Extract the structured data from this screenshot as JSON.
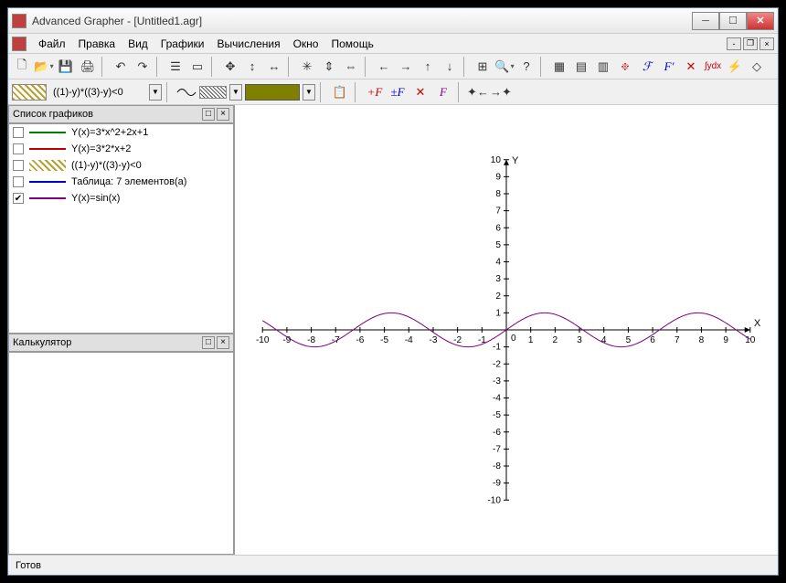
{
  "window": {
    "title": "Advanced Grapher - [Untitled1.agr]"
  },
  "menu": {
    "file": "Файл",
    "edit": "Правка",
    "view": "Вид",
    "graphs": "Графики",
    "calc": "Вычисления",
    "window": "Окно",
    "help": "Помощь"
  },
  "toolbar2": {
    "formula": "((1)-y)*((3)-y)<0"
  },
  "sidebar": {
    "graphs_title": "Список графиков",
    "calc_title": "Калькулятор",
    "items": [
      {
        "checked": false,
        "style": "line-green",
        "label": "Y(x)=3*x^2+2x+1"
      },
      {
        "checked": false,
        "style": "line-red",
        "label": "Y(x)=3*2*x+2"
      },
      {
        "checked": false,
        "style": "line-hatch",
        "label": "((1)-y)*((3)-y)<0"
      },
      {
        "checked": false,
        "style": "line-blue",
        "label": "Таблица: 7 элементов(а)"
      },
      {
        "checked": true,
        "style": "line-purple",
        "label": "Y(x)=sin(x)"
      }
    ]
  },
  "status": {
    "text": "Готов"
  },
  "chart_data": {
    "type": "line",
    "title": "",
    "xlabel": "X",
    "ylabel": "Y",
    "xlim": [
      -10,
      10
    ],
    "ylim": [
      -10,
      10
    ],
    "xticks": [
      -10,
      -9,
      -8,
      -7,
      -6,
      -5,
      -4,
      -3,
      -2,
      -1,
      0,
      1,
      2,
      3,
      4,
      5,
      6,
      7,
      8,
      9,
      10
    ],
    "yticks": [
      -10,
      -9,
      -8,
      -7,
      -6,
      -5,
      -4,
      -3,
      -2,
      -1,
      1,
      2,
      3,
      4,
      5,
      6,
      7,
      8,
      9,
      10
    ],
    "series": [
      {
        "name": "Y(x)=sin(x)",
        "function": "sin(x)",
        "color": "#800080"
      }
    ]
  }
}
